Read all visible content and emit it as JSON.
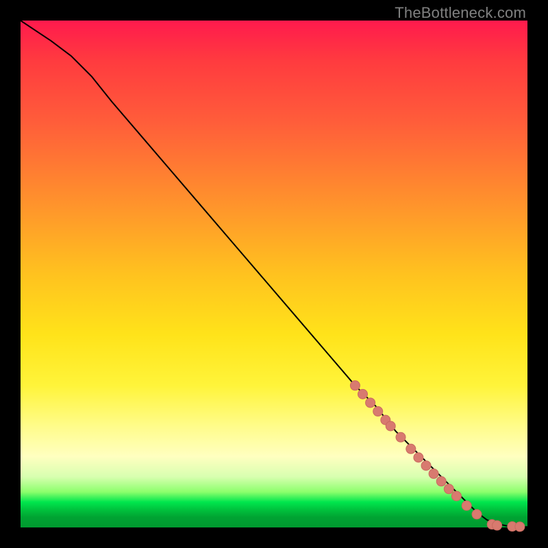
{
  "watermark": "TheBottleneck.com",
  "colors": {
    "curve_stroke": "#000000",
    "dot_fill": "#d87a6f",
    "dot_stroke": "#c96a5f"
  },
  "chart_data": {
    "type": "line",
    "title": "",
    "xlabel": "",
    "ylabel": "",
    "xlim": [
      0,
      100
    ],
    "ylim": [
      0,
      100
    ],
    "series": [
      {
        "name": "curve",
        "x": [
          0,
          3,
          6,
          10,
          14,
          18,
          24,
          30,
          36,
          42,
          48,
          54,
          60,
          66,
          70,
          74,
          78,
          82,
          85,
          88,
          90,
          92,
          94,
          96,
          98,
          100
        ],
        "y": [
          100,
          98,
          96,
          93,
          89,
          84,
          77,
          70,
          63,
          56,
          49,
          42,
          35,
          28,
          24,
          19,
          15,
          11,
          8,
          5,
          3,
          1.5,
          0.7,
          0.3,
          0.2,
          0.1
        ]
      }
    ],
    "points": {
      "name": "dots",
      "x": [
        66,
        67.5,
        69,
        70.5,
        72,
        73,
        75,
        77,
        78.5,
        80,
        81.5,
        83,
        84.5,
        86,
        88,
        90,
        93,
        94,
        97,
        98.5
      ],
      "y": [
        28,
        26.3,
        24.6,
        22.9,
        21.2,
        20.0,
        17.8,
        15.5,
        13.8,
        12.2,
        10.6,
        9.1,
        7.6,
        6.2,
        4.3,
        2.6,
        0.6,
        0.4,
        0.2,
        0.15
      ]
    }
  }
}
